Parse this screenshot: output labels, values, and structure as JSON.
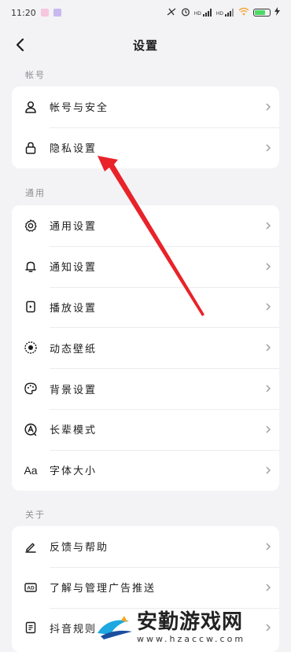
{
  "status_bar": {
    "time": "11:20",
    "hd1": "HD",
    "hd2": "HD",
    "battery_label": "100"
  },
  "header": {
    "title": "设置"
  },
  "sections": {
    "account": {
      "label": "帐号",
      "items": [
        {
          "label": "帐号与安全",
          "icon": "user-icon"
        },
        {
          "label": "隐私设置",
          "icon": "lock-icon"
        }
      ]
    },
    "general": {
      "label": "通用",
      "items": [
        {
          "label": "通用设置",
          "icon": "gear-icon"
        },
        {
          "label": "通知设置",
          "icon": "bell-icon"
        },
        {
          "label": "播放设置",
          "icon": "play-settings-icon"
        },
        {
          "label": "动态壁纸",
          "icon": "live-wallpaper-icon"
        },
        {
          "label": "背景设置",
          "icon": "palette-icon"
        },
        {
          "label": "长辈模式",
          "icon": "elder-mode-icon"
        },
        {
          "label": "字体大小",
          "icon": "font-size-icon"
        }
      ]
    },
    "about": {
      "label": "关于",
      "items": [
        {
          "label": "反馈与帮助",
          "icon": "edit-pen-icon"
        },
        {
          "label": "了解与管理广告推送",
          "icon": "ad-icon"
        },
        {
          "label": "抖音规则",
          "icon": "rules-doc-icon"
        }
      ]
    }
  },
  "watermark": {
    "title": "安勤游戏网",
    "url": "www.hzaccw.com"
  },
  "colors": {
    "background": "#f3f3f5",
    "card": "#ffffff",
    "annotation_arrow": "#e8232a"
  }
}
